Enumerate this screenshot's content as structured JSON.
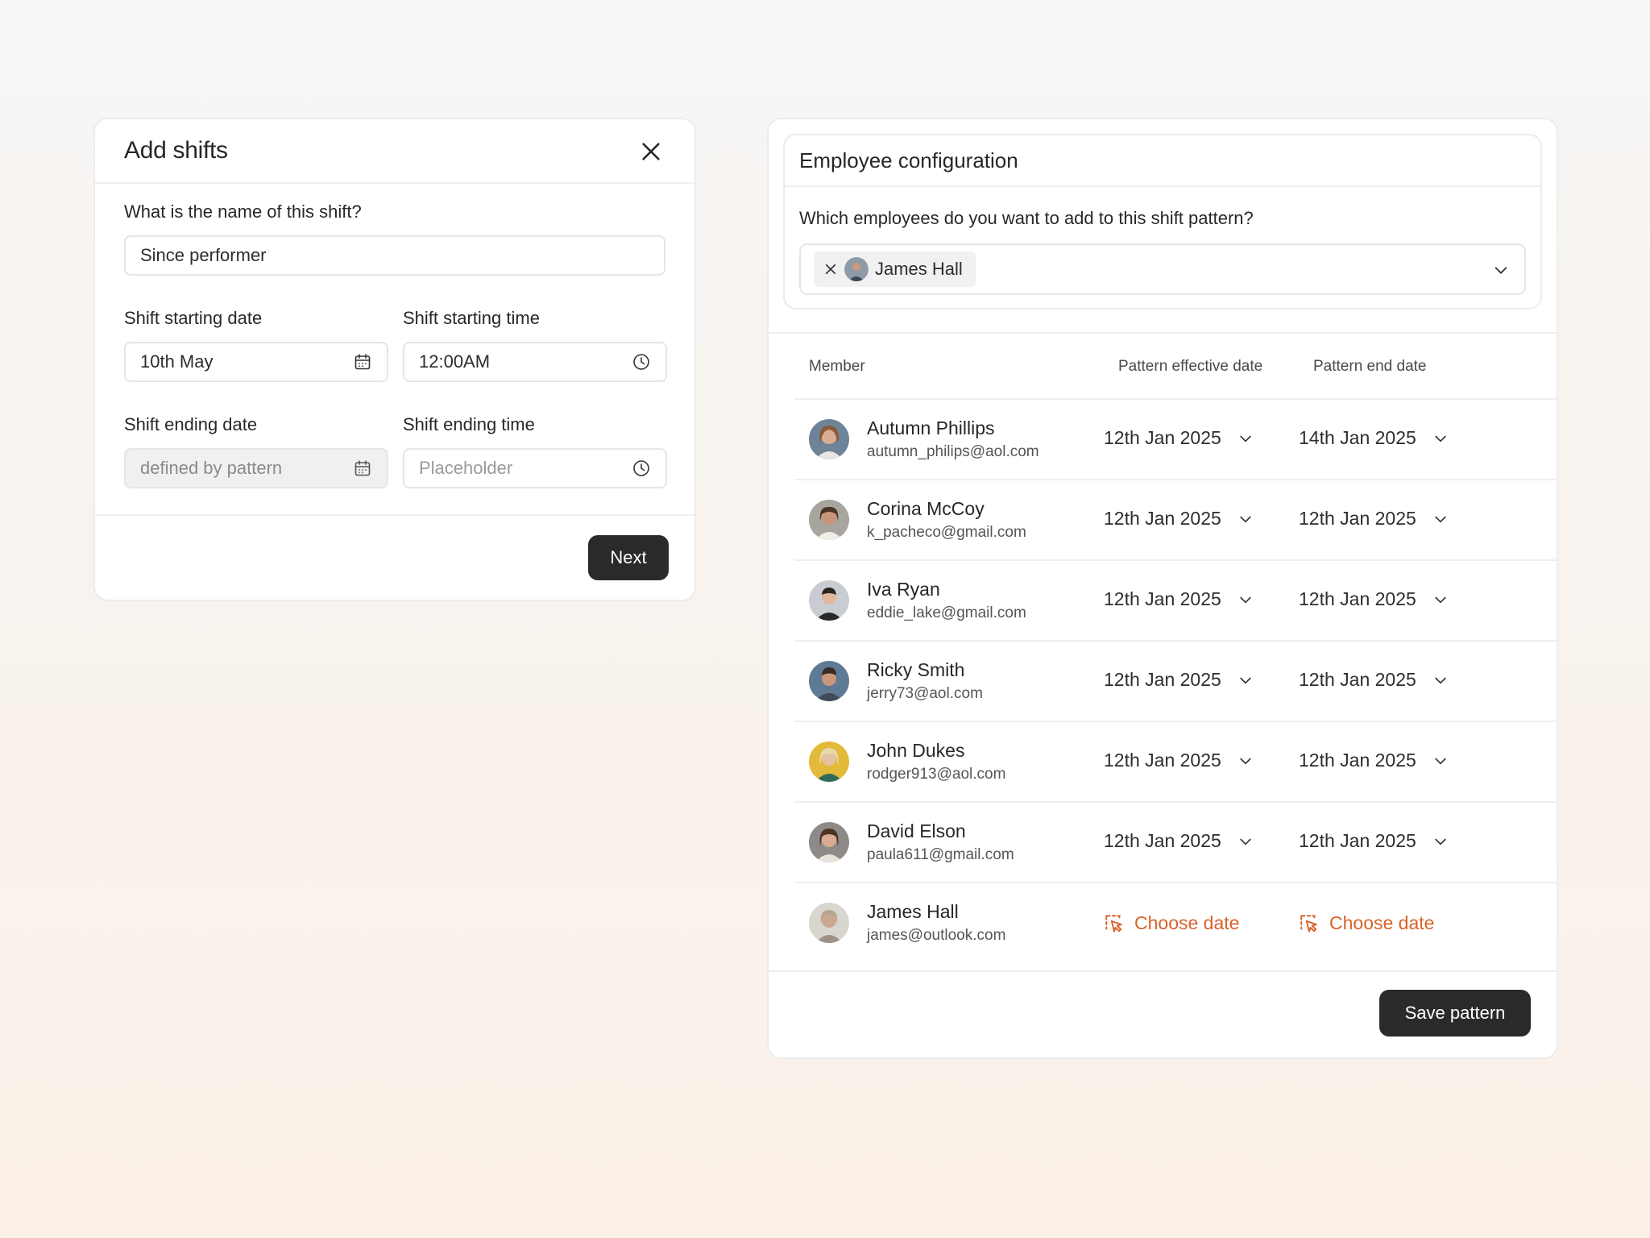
{
  "add_shifts": {
    "title": "Add shifts",
    "name_question": "What is the name of this shift?",
    "name_value": "Since performer",
    "start_date_label": "Shift starting date",
    "start_date_value": "10th May",
    "start_time_label": "Shift starting time",
    "start_time_value": "12:00AM",
    "end_date_label": "Shift ending date",
    "end_date_value": "defined by pattern",
    "end_time_label": "Shift ending time",
    "end_time_placeholder": "Placeholder",
    "next_label": "Next"
  },
  "employee_config": {
    "title": "Employee configuration",
    "question": "Which employees do you want to add to this shift pattern?",
    "selected_chip": "James Hall",
    "columns": {
      "member": "Member",
      "effective": "Pattern effective date",
      "end": "Pattern end date"
    },
    "choose_date_label": "Choose date",
    "save_label": "Save pattern",
    "members": [
      {
        "name": "Autumn Phillips",
        "email": "autumn_philips@aol.com",
        "effective": "12th Jan 2025",
        "end": "14th Jan 2025"
      },
      {
        "name": "Corina McCoy",
        "email": "k_pacheco@gmail.com",
        "effective": "12th Jan 2025",
        "end": "12th Jan 2025"
      },
      {
        "name": "Iva Ryan",
        "email": "eddie_lake@gmail.com",
        "effective": "12th Jan 2025",
        "end": "12th Jan 2025"
      },
      {
        "name": "Ricky Smith",
        "email": "jerry73@aol.com",
        "effective": "12th Jan 2025",
        "end": "12th Jan 2025"
      },
      {
        "name": "John Dukes",
        "email": "rodger913@aol.com",
        "effective": "12th Jan 2025",
        "end": "12th Jan 2025"
      },
      {
        "name": "David Elson",
        "email": "paula611@gmail.com",
        "effective": "12th Jan 2025",
        "end": "12th Jan 2025"
      },
      {
        "name": "James Hall",
        "email": "james@outlook.com"
      }
    ]
  },
  "colors": {
    "accent": "#d9622b",
    "button_dark": "#2a2a2a"
  }
}
